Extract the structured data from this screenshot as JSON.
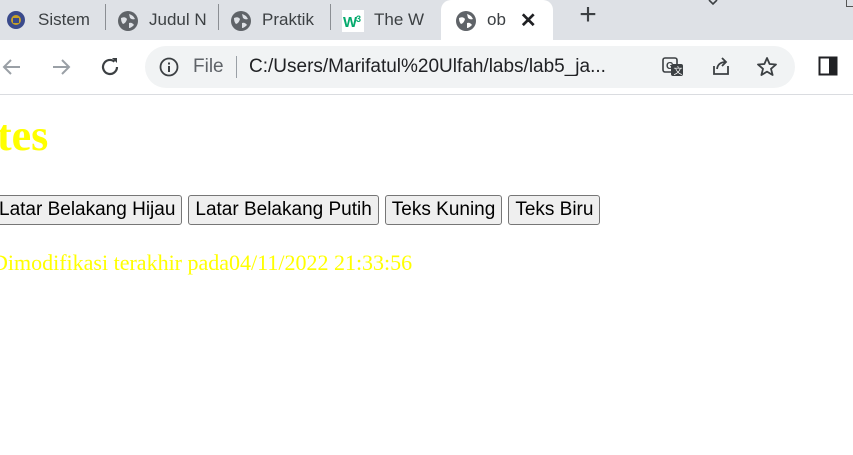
{
  "browser": {
    "tabs": [
      {
        "title": "Sistem",
        "icon": "site-logo-icon"
      },
      {
        "title": "Judul N",
        "icon": "globe-icon"
      },
      {
        "title": "Praktik",
        "icon": "globe-icon"
      },
      {
        "title": "The W",
        "icon": "w3schools-icon"
      },
      {
        "title": "ob",
        "icon": "globe-icon",
        "active": true
      }
    ],
    "new_tab_label": "+",
    "close_label": "✕",
    "address": {
      "scheme_label": "File",
      "url": "C:/Users/Marifatul%20Ulfah/labs/lab5_ja..."
    }
  },
  "page": {
    "heading": "tes",
    "buttons": [
      "Latar Belakang Hijau",
      "Latar Belakang Putih",
      "Teks Kuning",
      "Teks Biru"
    ],
    "modified_text": "Dimodifikasi terakhir pada04/11/2022 21:33:56"
  },
  "colors": {
    "text_color": "#ffff00",
    "tabstrip_bg": "#dee1e6",
    "w3_brand": "#04aa6d"
  }
}
